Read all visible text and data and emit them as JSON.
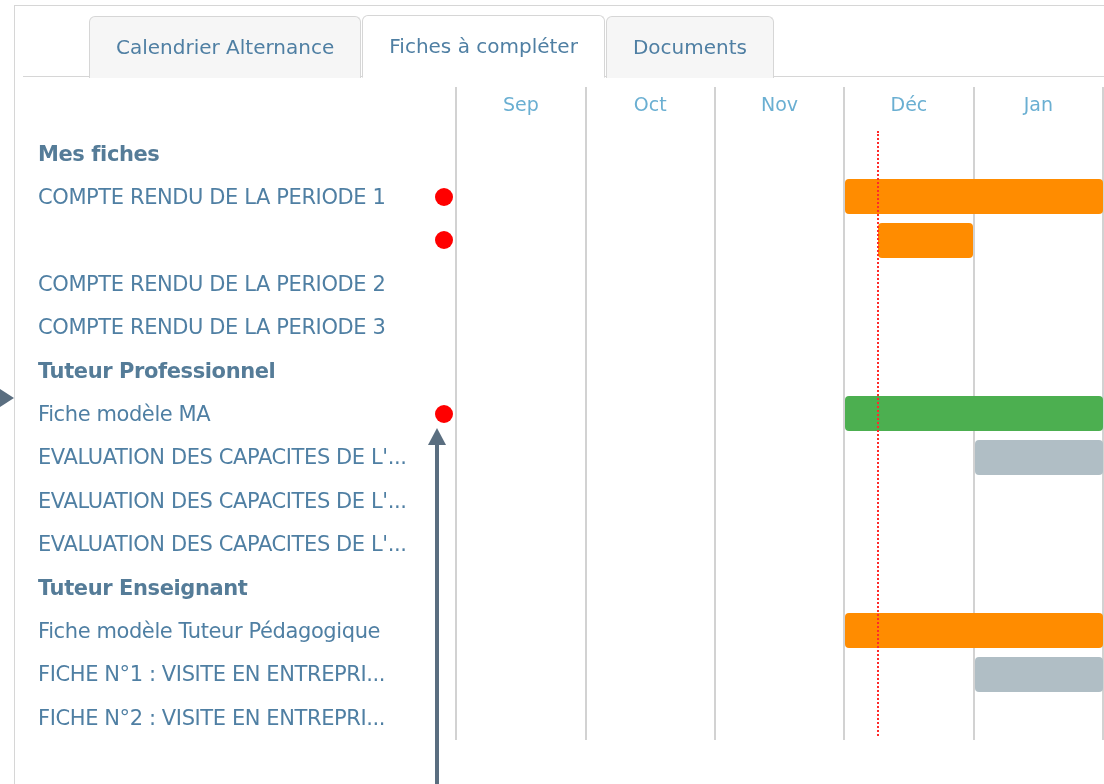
{
  "tabs": [
    {
      "label": "Calendrier Alternance",
      "selected": false
    },
    {
      "label": "Fiches à compléter",
      "selected": true
    },
    {
      "label": "Documents",
      "selected": false
    }
  ],
  "months": [
    "Sep",
    "Oct",
    "Nov",
    "Déc",
    "Jan"
  ],
  "rows": [
    {
      "kind": "section",
      "label": "Mes fiches"
    },
    {
      "kind": "item",
      "label": "COMPTE RENDU DE LA PERIODE 1",
      "alert": true,
      "bar": {
        "kind": "long",
        "color": "#ff8c00"
      }
    },
    {
      "kind": "item",
      "alert": true,
      "bar": {
        "kind": "short",
        "color": "#ff8c00"
      }
    },
    {
      "kind": "item",
      "label": "COMPTE RENDU DE LA PERIODE 2",
      "alert": false
    },
    {
      "kind": "item",
      "label": "COMPTE RENDU DE LA PERIODE 3",
      "alert": false
    },
    {
      "kind": "section",
      "label": "Tuteur Professionnel"
    },
    {
      "kind": "item",
      "label": "Fiche modèle MA",
      "alert": true,
      "bar": {
        "kind": "long",
        "color": "#4caf50"
      }
    },
    {
      "kind": "item",
      "label": "EVALUATION DES CAPACITES DE L'...",
      "alert": false,
      "bar": {
        "kind": "late",
        "color": "#b0bec5"
      }
    },
    {
      "kind": "item",
      "label": "EVALUATION DES CAPACITES DE L'...",
      "alert": false
    },
    {
      "kind": "item",
      "label": "EVALUATION DES CAPACITES DE L'...",
      "alert": false
    },
    {
      "kind": "section",
      "label": "Tuteur Enseignant"
    },
    {
      "kind": "item",
      "label": "Fiche modèle Tuteur Pédagogique",
      "alert": false,
      "bar": {
        "kind": "long",
        "color": "#ff8c00"
      }
    },
    {
      "kind": "item",
      "label": "FICHE N°1 : VISITE EN ENTREPRI...",
      "alert": false,
      "bar": {
        "kind": "late",
        "color": "#b0bec5"
      }
    },
    {
      "kind": "item",
      "label": "FICHE N°2 : VISITE EN ENTREPRI...",
      "alert": false
    }
  ]
}
